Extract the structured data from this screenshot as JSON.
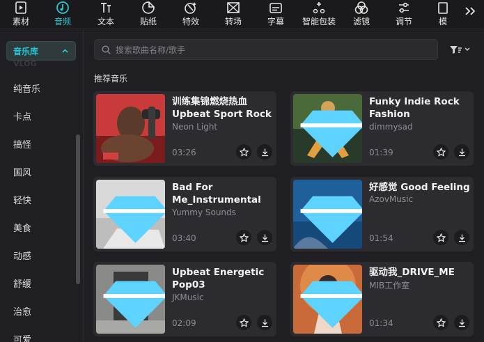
{
  "toolbar": {
    "items": [
      {
        "label": "素材",
        "icon": "media-icon"
      },
      {
        "label": "音频",
        "icon": "audio-icon",
        "active": true
      },
      {
        "label": "文本",
        "icon": "text-icon"
      },
      {
        "label": "贴纸",
        "icon": "sticker-icon"
      },
      {
        "label": "特效",
        "icon": "effects-icon"
      },
      {
        "label": "转场",
        "icon": "transition-icon"
      },
      {
        "label": "字幕",
        "icon": "subtitle-icon"
      },
      {
        "label": "智能包装",
        "icon": "smart-pack-icon"
      },
      {
        "label": "滤镜",
        "icon": "filter-icon"
      },
      {
        "label": "调节",
        "icon": "adjust-icon"
      },
      {
        "label": "模",
        "icon": "template-icon"
      }
    ],
    "more": ">>"
  },
  "sidebar": {
    "selected_category": "音乐库",
    "hidden_item": "VLOG",
    "items": [
      "纯音乐",
      "卡点",
      "搞怪",
      "国风",
      "轻快",
      "美食",
      "动感",
      "舒缓",
      "治愈",
      "可爱"
    ]
  },
  "search": {
    "placeholder": "搜索歌曲名称/歌手",
    "value": ""
  },
  "section_title": "推荐音乐",
  "tracks": [
    {
      "title": "训练集锦燃烧热血 Upbeat Sport Rock ...",
      "artist": "Neon Light",
      "duration": "03:26",
      "vip": false
    },
    {
      "title": "Funky Indie Rock Fashion",
      "artist": "dimmysad",
      "duration": "01:39",
      "vip": true
    },
    {
      "title": "Bad For Me_Instrumental",
      "artist": "Yummy Sounds",
      "duration": "03:40",
      "vip": true
    },
    {
      "title": "好感觉  Good Feeling",
      "artist": "AzovMusic",
      "duration": "01:54",
      "vip": true
    },
    {
      "title": "Upbeat Energetic Pop03",
      "artist": "JKMusic",
      "duration": "02:09",
      "vip": true
    },
    {
      "title": "驱动我_DRIVE_ME",
      "artist": "MIB工作室",
      "duration": "01:34",
      "vip": true
    }
  ],
  "colors": {
    "accent": "#28c7d6",
    "background": "#1f1f23",
    "card": "#2c2c30",
    "vip": "#5fd3ff"
  }
}
